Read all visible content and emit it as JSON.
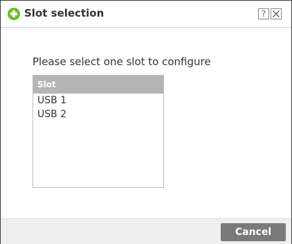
{
  "dialog": {
    "title": "Slot selection",
    "help_label": "?",
    "prompt": "Please select one slot to configure"
  },
  "slot_table": {
    "header": "Slot",
    "rows": [
      "USB 1",
      "USB 2"
    ]
  },
  "footer": {
    "cancel_label": "Cancel"
  },
  "icons": {
    "title": "plus-circle-icon",
    "help": "help-icon",
    "close": "close-icon"
  },
  "colors": {
    "accent": "#6dbb2f",
    "header_bg": "#b5b5b5",
    "button_bg": "#7a7a7a"
  }
}
